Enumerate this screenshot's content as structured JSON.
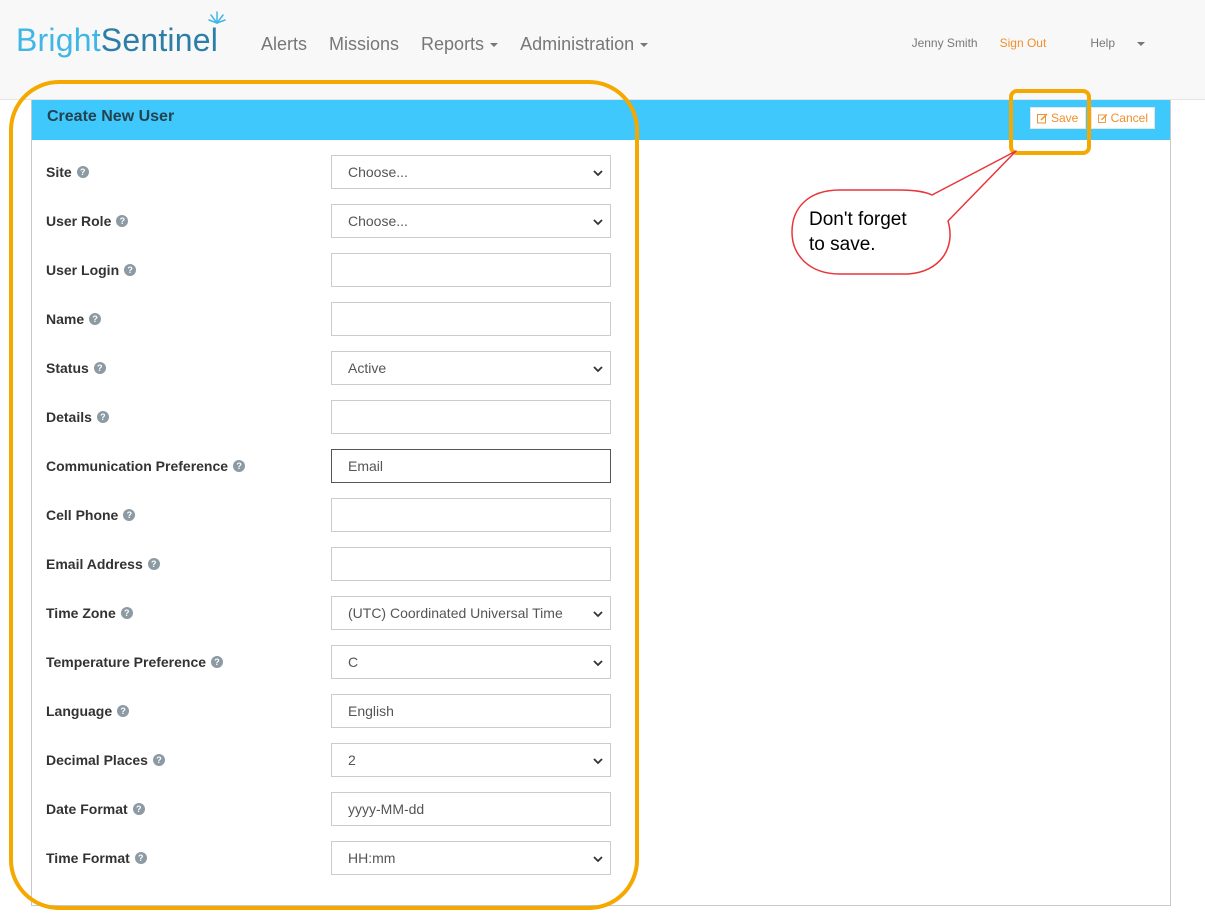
{
  "brand": {
    "part1": "Bright",
    "part2": "Sentinel"
  },
  "nav": {
    "alerts": "Alerts",
    "missions": "Missions",
    "reports": "Reports",
    "administration": "Administration",
    "user": "Jenny Smith",
    "signout": "Sign Out",
    "help": "Help"
  },
  "panel": {
    "title": "Create New User",
    "save_label": "Save",
    "cancel_label": "Cancel"
  },
  "form": {
    "site": {
      "label": "Site",
      "value": "Choose..."
    },
    "user_role": {
      "label": "User Role",
      "value": "Choose..."
    },
    "user_login": {
      "label": "User Login",
      "value": ""
    },
    "name": {
      "label": "Name",
      "value": ""
    },
    "status": {
      "label": "Status",
      "value": "Active"
    },
    "details": {
      "label": "Details",
      "value": ""
    },
    "communication": {
      "label": "Communication Preference",
      "value": "Email"
    },
    "cell_phone": {
      "label": "Cell Phone",
      "value": ""
    },
    "email": {
      "label": "Email Address",
      "value": ""
    },
    "time_zone": {
      "label": "Time Zone",
      "value": "(UTC) Coordinated Universal Time"
    },
    "temperature": {
      "label": "Temperature Preference",
      "value": "C"
    },
    "language": {
      "label": "Language",
      "value": "English"
    },
    "decimal": {
      "label": "Decimal Places",
      "value": "2"
    },
    "date_format": {
      "label": "Date Format",
      "value": "yyyy-MM-dd"
    },
    "time_format": {
      "label": "Time Format",
      "value": "HH:mm"
    }
  },
  "annotation": {
    "line1": "Don't forget",
    "line2": "to save."
  },
  "colors": {
    "accent_blue": "#3ec8fb",
    "highlight_orange": "#f5a800",
    "link_orange": "#f0902b",
    "bubble_red": "#e8353a"
  }
}
